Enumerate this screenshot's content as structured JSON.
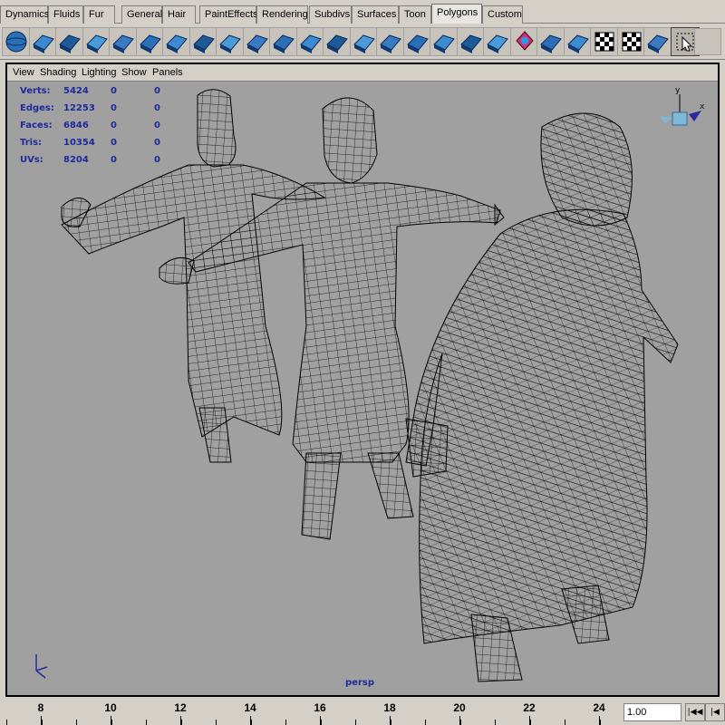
{
  "shelf_tabs": [
    "Dynamics",
    "Fluids",
    "Fur",
    "General",
    "Hair",
    "PaintEffects",
    "Rendering",
    "Subdivs",
    "Surfaces",
    "Toon",
    "Polygons",
    "Custom"
  ],
  "active_tab": "Polygons",
  "shelf_icons": [
    "sphere-icon",
    "cube-icon",
    "cylinder-icon",
    "cone-icon",
    "plane-icon",
    "torus-icon",
    "combine-icon",
    "separate-icon",
    "extract-icon",
    "smooth-icon",
    "extrude-face-icon",
    "extrude-edge-icon",
    "split-polygon-icon",
    "append-polygon-icon",
    "cut-faces-icon",
    "bevel-icon",
    "merge-vertices-icon",
    "subdivide-icon",
    "poke-icon",
    "uv-planar-icon",
    "uv-cylindrical-icon",
    "auto-map-icon",
    "checker-icon",
    "layout-uv-icon",
    "uv-editor-icon",
    "marquee-select-icon"
  ],
  "panel_menu": [
    "View",
    "Shading",
    "Lighting",
    "Show",
    "Panels"
  ],
  "hud": [
    {
      "label": "Verts:",
      "v1": "5424",
      "v2": "0",
      "v3": "0"
    },
    {
      "label": "Edges:",
      "v1": "12253",
      "v2": "0",
      "v3": "0"
    },
    {
      "label": "Faces:",
      "v1": "6846",
      "v2": "0",
      "v3": "0"
    },
    {
      "label": "Tris:",
      "v1": "10354",
      "v2": "0",
      "v3": "0"
    },
    {
      "label": "UVs:",
      "v1": "8204",
      "v2": "0",
      "v3": "0"
    }
  ],
  "camera_label": "persp",
  "view_cube_axes": {
    "y": "y",
    "x": "x"
  },
  "time_slider_ticks": [
    "8",
    "10",
    "12",
    "14",
    "16",
    "18",
    "20",
    "22",
    "24"
  ],
  "current_frame": "1.00",
  "playback": [
    "|◀◀",
    "|◀"
  ],
  "colors": {
    "viewport_bg": "#a0a0a0",
    "ui_bg": "#d4d0c8",
    "hud_text": "#1e2a9a",
    "wire": "#000000"
  }
}
